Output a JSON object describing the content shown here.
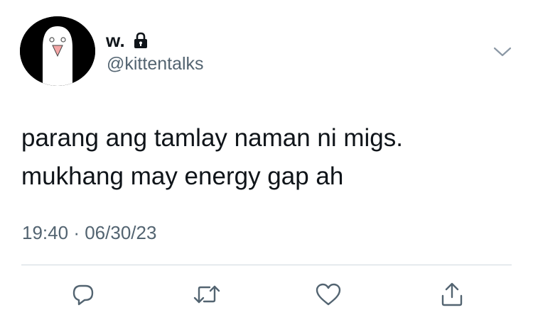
{
  "tweet": {
    "display_name": "w.",
    "handle": "@kittentalks",
    "text": "parang ang tamlay naman ni migs.\nmukhang may energy gap ah",
    "time": "19:40",
    "separator": "·",
    "date": "06/30/23"
  },
  "icons": {
    "avatar": "avatar-ghost-icon",
    "lock": "lock-icon",
    "menu": "chevron-down-icon",
    "reply": "reply-icon",
    "retweet": "retweet-icon",
    "like": "heart-icon",
    "share": "share-icon"
  },
  "colors": {
    "text": "#0f1419",
    "secondary": "#536471",
    "icon": "#536471",
    "divider": "#cfd9de",
    "beak": "#f4a6a6"
  }
}
